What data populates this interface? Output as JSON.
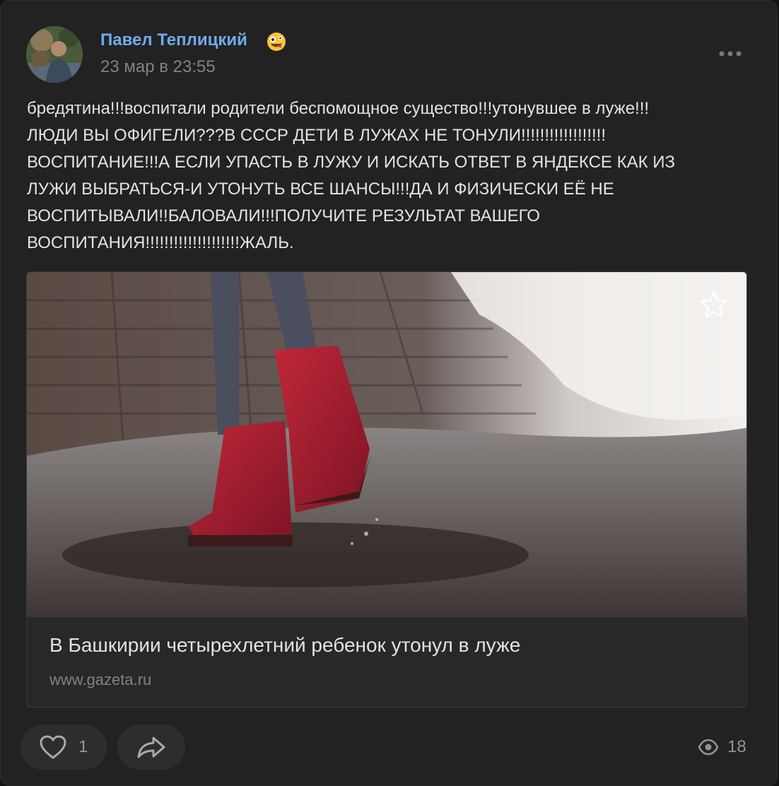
{
  "author": {
    "name": "Павел Теплицкий",
    "avatar_icon": "avatar-photo",
    "status_emoji": "zany-face-emoji"
  },
  "post": {
    "date": "23 мар в 23:55",
    "text": "бредятина!!!воспитали родители беспомощное существо!!!утонувшее в луже!!!\nЛЮДИ ВЫ ОФИГЕЛИ???В СССР ДЕТИ В ЛУЖАХ НЕ ТОНУЛИ!!!!!!!!!!!!!!!!!!\nВОСПИТАНИЕ!!!А ЕСЛИ УПАСТЬ В ЛУЖУ И ИСКАТЬ ОТВЕТ В ЯНДЕКСЕ КАК ИЗ\nЛУЖИ ВЫБРАТЬСЯ-И УТОНУТЬ ВСЕ ШАНСЫ!!!ДА И ФИЗИЧЕСКИ ЕЁ НЕ\nВОСПИТЫВАЛИ!!БАЛОВАЛИ!!!ПОЛУЧИТЕ РЕЗУЛЬТАТ ВАШЕГО\nВОСПИТАНИЯ!!!!!!!!!!!!!!!!!!!!ЖАЛЬ."
  },
  "attachment": {
    "title": "В Башкирии четырехлетний ребенок утонул в луже",
    "url": "www.gazeta.ru",
    "photo_icon": "child-red-boots-puddle-photo"
  },
  "actions": {
    "likes": "1",
    "views": "18"
  },
  "colors": {
    "background": "#222222",
    "author_link": "#71aaeb",
    "secondary_text": "#828282",
    "primary_text": "#e1e3e6",
    "button_bg": "#2d2d2d"
  }
}
